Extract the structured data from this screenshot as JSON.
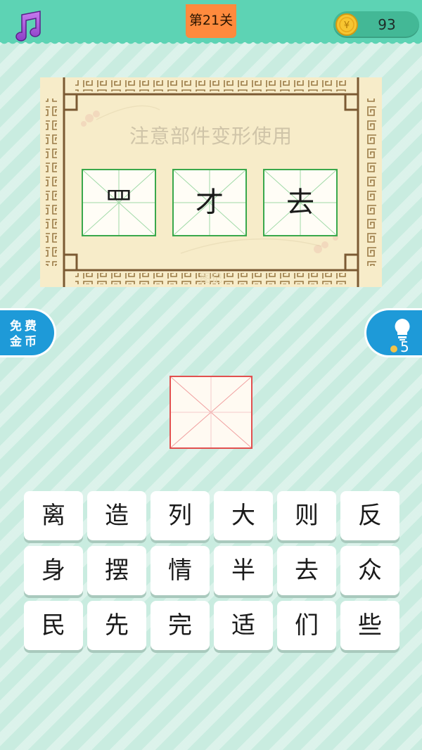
{
  "header": {
    "music_icon": "music-note-icon",
    "level_label": "第21关",
    "coin_icon": "gold-coin-icon",
    "coins": "93"
  },
  "puzzle": {
    "hint": "注意部件变形使用",
    "clues": [
      "罒",
      "才",
      "去"
    ],
    "watermark": "图记"
  },
  "side": {
    "free_coins_label": "免费\n金币",
    "hint_icon": "lightbulb-icon",
    "hint_count": "5"
  },
  "answer": {
    "value": ""
  },
  "keyboard": {
    "rows": [
      [
        "离",
        "造",
        "列",
        "大",
        "则",
        "反"
      ],
      [
        "身",
        "摆",
        "情",
        "半",
        "去",
        "众"
      ],
      [
        "民",
        "先",
        "完",
        "适",
        "们",
        "些"
      ]
    ]
  },
  "colors": {
    "header": "#5dd3b4",
    "level_badge": "#ff8a3d",
    "side_buttons": "#1e9ad8",
    "clue_grid": "#3aa84c",
    "answer_grid": "#e2504f"
  }
}
